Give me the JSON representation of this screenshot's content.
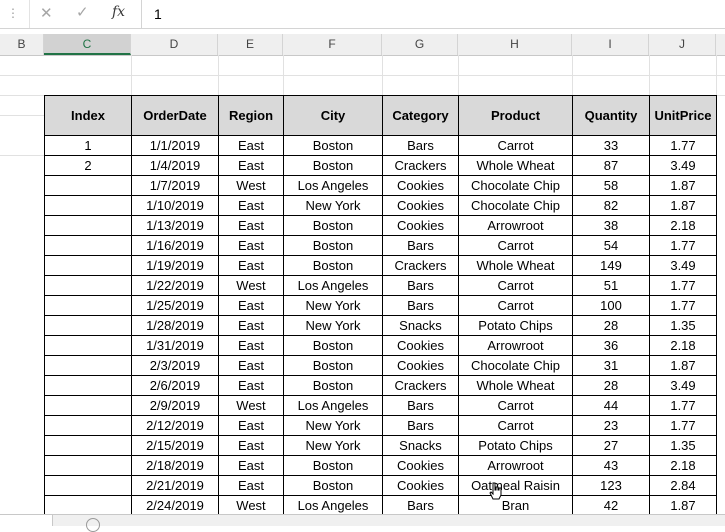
{
  "formula_bar": {
    "cancel_icon": "✕",
    "enter_icon": "✓",
    "fx_label": "fx",
    "value": "1"
  },
  "columns": [
    {
      "letter": "B"
    },
    {
      "letter": "C",
      "selected": true
    },
    {
      "letter": "D"
    },
    {
      "letter": "E"
    },
    {
      "letter": "F"
    },
    {
      "letter": "G"
    },
    {
      "letter": "H"
    },
    {
      "letter": "I"
    },
    {
      "letter": "J"
    }
  ],
  "table": {
    "headers": [
      "Index",
      "OrderDate",
      "Region",
      "City",
      "Category",
      "Product",
      "Quantity",
      "UnitPrice"
    ],
    "rows": [
      [
        "1",
        "1/1/2019",
        "East",
        "Boston",
        "Bars",
        "Carrot",
        "33",
        "1.77"
      ],
      [
        "2",
        "1/4/2019",
        "East",
        "Boston",
        "Crackers",
        "Whole Wheat",
        "87",
        "3.49"
      ],
      [
        "",
        "1/7/2019",
        "West",
        "Los Angeles",
        "Cookies",
        "Chocolate Chip",
        "58",
        "1.87"
      ],
      [
        "",
        "1/10/2019",
        "East",
        "New York",
        "Cookies",
        "Chocolate Chip",
        "82",
        "1.87"
      ],
      [
        "",
        "1/13/2019",
        "East",
        "Boston",
        "Cookies",
        "Arrowroot",
        "38",
        "2.18"
      ],
      [
        "",
        "1/16/2019",
        "East",
        "Boston",
        "Bars",
        "Carrot",
        "54",
        "1.77"
      ],
      [
        "",
        "1/19/2019",
        "East",
        "Boston",
        "Crackers",
        "Whole Wheat",
        "149",
        "3.49"
      ],
      [
        "",
        "1/22/2019",
        "West",
        "Los Angeles",
        "Bars",
        "Carrot",
        "51",
        "1.77"
      ],
      [
        "",
        "1/25/2019",
        "East",
        "New York",
        "Bars",
        "Carrot",
        "100",
        "1.77"
      ],
      [
        "",
        "1/28/2019",
        "East",
        "New York",
        "Snacks",
        "Potato Chips",
        "28",
        "1.35"
      ],
      [
        "",
        "1/31/2019",
        "East",
        "Boston",
        "Cookies",
        "Arrowroot",
        "36",
        "2.18"
      ],
      [
        "",
        "2/3/2019",
        "East",
        "Boston",
        "Cookies",
        "Chocolate Chip",
        "31",
        "1.87"
      ],
      [
        "",
        "2/6/2019",
        "East",
        "Boston",
        "Crackers",
        "Whole Wheat",
        "28",
        "3.49"
      ],
      [
        "",
        "2/9/2019",
        "West",
        "Los Angeles",
        "Bars",
        "Carrot",
        "44",
        "1.77"
      ],
      [
        "",
        "2/12/2019",
        "East",
        "New York",
        "Bars",
        "Carrot",
        "23",
        "1.77"
      ],
      [
        "",
        "2/15/2019",
        "East",
        "New York",
        "Snacks",
        "Potato Chips",
        "27",
        "1.35"
      ],
      [
        "",
        "2/18/2019",
        "East",
        "Boston",
        "Cookies",
        "Arrowroot",
        "43",
        "2.18"
      ],
      [
        "",
        "2/21/2019",
        "East",
        "Boston",
        "Cookies",
        "Oatmeal Raisin",
        "123",
        "2.84"
      ],
      [
        "",
        "2/24/2019",
        "West",
        "Los Angeles",
        "Bars",
        "Bran",
        "42",
        "1.87"
      ]
    ]
  },
  "colors": {
    "accent": "#217346",
    "header_fill": "#d9d9d9"
  }
}
